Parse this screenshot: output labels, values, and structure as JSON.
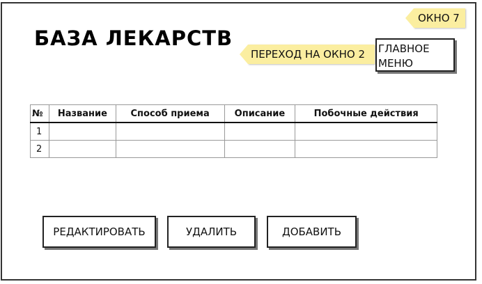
{
  "header": {
    "title": "БАЗА ЛЕКАРСТВ"
  },
  "notes": {
    "window_label": "ОКНО 7",
    "goto_label": "ПЕРЕХОД НА ОКНО 2"
  },
  "menu": {
    "main_menu_label": "ГЛАВНОЕ\nМЕНЮ"
  },
  "table": {
    "columns": [
      "№",
      "Название",
      "Способ приема",
      "Описание",
      "Побочные действия"
    ],
    "rows": [
      {
        "num": "1",
        "name": "",
        "method": "",
        "description": "",
        "side_effects": ""
      },
      {
        "num": "2",
        "name": "",
        "method": "",
        "description": "",
        "side_effects": ""
      }
    ]
  },
  "actions": {
    "edit_label": "РЕДАКТИРОВАТЬ",
    "delete_label": "УДАЛИТЬ",
    "add_label": "ДОБАВИТЬ"
  }
}
